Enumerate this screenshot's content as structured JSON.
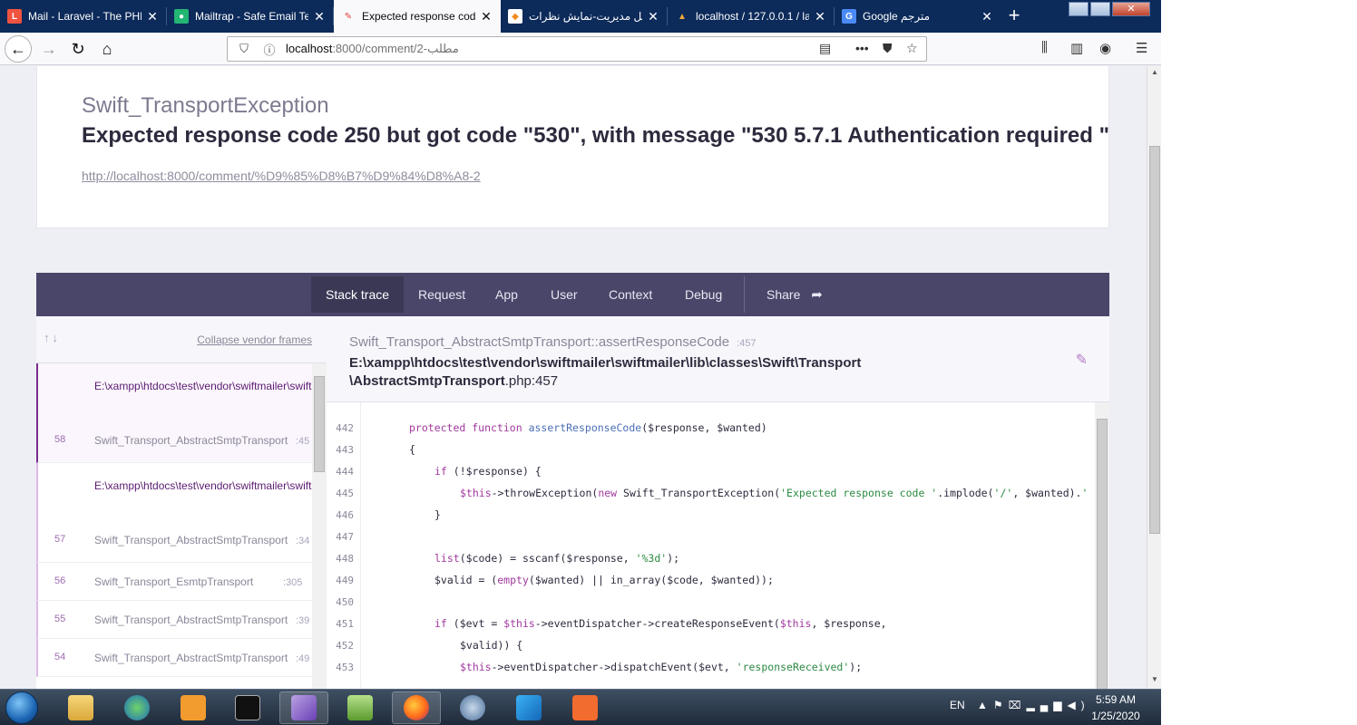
{
  "browser": {
    "tabs": [
      {
        "label": "Mail - Laravel - The PHP",
        "icon": "laravel-icon",
        "color": "#f05340"
      },
      {
        "label": "Mailtrap - Safe Email Te",
        "icon": "mailtrap-icon",
        "color": "#22b573"
      },
      {
        "label": "Expected response code",
        "icon": "ignition-icon",
        "color": "#e4443d",
        "active": true
      },
      {
        "label": "پنل مدیریت-نمایش نظرات",
        "icon": "admin-icon",
        "color": "#f28b20"
      },
      {
        "label": "localhost / 127.0.0.1 / la",
        "icon": "phpmyadmin-icon",
        "color": "#f2a93b"
      },
      {
        "label": "Google مترجم",
        "icon": "google-translate-icon",
        "color": "#4a8af4"
      }
    ],
    "new_tab_glyph": "+",
    "url": {
      "host": "localhost",
      "path": ":8000/comment/2-مطلب"
    }
  },
  "exception": {
    "class": "Swift_TransportException",
    "message": "Expected response code 250 but got code \"530\", with message \"530 5.7.1 Authentication required \"",
    "url": "http://localhost:8000/comment/%D9%85%D8%B7%D9%84%D8%A8-2"
  },
  "flare_tabs": [
    "Stack trace",
    "Request",
    "App",
    "User",
    "Context",
    "Debug",
    "Share"
  ],
  "frames_panel": {
    "collapse_label": "Collapse vendor frames",
    "frames": [
      {
        "file": "E:\\xampp\\htdocs\\test\\vendor\\swiftmailer\\swiftmailer\\lib\\classes\\Swift\\Transport\\AbstractSmtpTransport.php",
        "number": "58",
        "class": "Swift_Transport_AbstractSmtpTransport",
        "line": ":45"
      },
      {
        "file": "E:\\xampp\\htdocs\\test\\vendor\\swiftmailer\\swiftmailer\\lib\\classes\\Swift\\Transport\\AbstractSmtpTransport.php",
        "number": "57",
        "class": "Swift_Transport_AbstractSmtpTransport",
        "line": ":34"
      },
      {
        "number": "56",
        "class": "Swift_Transport_EsmtpTransport",
        "line": ":305"
      },
      {
        "number": "55",
        "class": "Swift_Transport_AbstractSmtpTransport",
        "line": ":39"
      },
      {
        "number": "54",
        "class": "Swift_Transport_AbstractSmtpTransport",
        "line": ":49"
      }
    ]
  },
  "code_panel": {
    "method_class": "Swift_Transport_AbstractSmtpTransport",
    "method_name": "::assertResponseCode",
    "method_line": ":457",
    "path_line1": "E:\\xampp\\htdocs\\test\\vendor\\swiftmailer\\swiftmailer\\lib\\classes\\Swift\\Transport",
    "path_line2": "\\AbstractSmtpTransport",
    "path_ext": ".php:457",
    "line_numbers": [
      "442",
      "443",
      "444",
      "445",
      "446",
      "447",
      "448",
      "449",
      "450",
      "451",
      "452",
      "453"
    ]
  },
  "taskbar": {
    "language": "EN",
    "time": "5:59 AM",
    "date": "1/25/2020"
  }
}
